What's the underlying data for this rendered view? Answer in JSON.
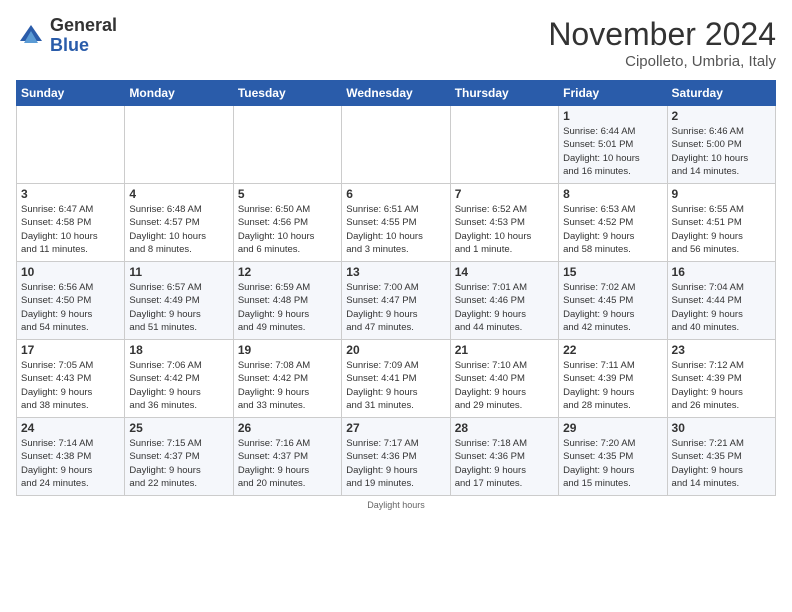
{
  "header": {
    "logo_general": "General",
    "logo_blue": "Blue",
    "month_title": "November 2024",
    "location": "Cipolleto, Umbria, Italy"
  },
  "calendar": {
    "days_of_week": [
      "Sunday",
      "Monday",
      "Tuesday",
      "Wednesday",
      "Thursday",
      "Friday",
      "Saturday"
    ],
    "footer_text": "Daylight hours",
    "weeks": [
      [
        {
          "day": "",
          "info": ""
        },
        {
          "day": "",
          "info": ""
        },
        {
          "day": "",
          "info": ""
        },
        {
          "day": "",
          "info": ""
        },
        {
          "day": "",
          "info": ""
        },
        {
          "day": "1",
          "info": "Sunrise: 6:44 AM\nSunset: 5:01 PM\nDaylight: 10 hours\nand 16 minutes."
        },
        {
          "day": "2",
          "info": "Sunrise: 6:46 AM\nSunset: 5:00 PM\nDaylight: 10 hours\nand 14 minutes."
        }
      ],
      [
        {
          "day": "3",
          "info": "Sunrise: 6:47 AM\nSunset: 4:58 PM\nDaylight: 10 hours\nand 11 minutes."
        },
        {
          "day": "4",
          "info": "Sunrise: 6:48 AM\nSunset: 4:57 PM\nDaylight: 10 hours\nand 8 minutes."
        },
        {
          "day": "5",
          "info": "Sunrise: 6:50 AM\nSunset: 4:56 PM\nDaylight: 10 hours\nand 6 minutes."
        },
        {
          "day": "6",
          "info": "Sunrise: 6:51 AM\nSunset: 4:55 PM\nDaylight: 10 hours\nand 3 minutes."
        },
        {
          "day": "7",
          "info": "Sunrise: 6:52 AM\nSunset: 4:53 PM\nDaylight: 10 hours\nand 1 minute."
        },
        {
          "day": "8",
          "info": "Sunrise: 6:53 AM\nSunset: 4:52 PM\nDaylight: 9 hours\nand 58 minutes."
        },
        {
          "day": "9",
          "info": "Sunrise: 6:55 AM\nSunset: 4:51 PM\nDaylight: 9 hours\nand 56 minutes."
        }
      ],
      [
        {
          "day": "10",
          "info": "Sunrise: 6:56 AM\nSunset: 4:50 PM\nDaylight: 9 hours\nand 54 minutes."
        },
        {
          "day": "11",
          "info": "Sunrise: 6:57 AM\nSunset: 4:49 PM\nDaylight: 9 hours\nand 51 minutes."
        },
        {
          "day": "12",
          "info": "Sunrise: 6:59 AM\nSunset: 4:48 PM\nDaylight: 9 hours\nand 49 minutes."
        },
        {
          "day": "13",
          "info": "Sunrise: 7:00 AM\nSunset: 4:47 PM\nDaylight: 9 hours\nand 47 minutes."
        },
        {
          "day": "14",
          "info": "Sunrise: 7:01 AM\nSunset: 4:46 PM\nDaylight: 9 hours\nand 44 minutes."
        },
        {
          "day": "15",
          "info": "Sunrise: 7:02 AM\nSunset: 4:45 PM\nDaylight: 9 hours\nand 42 minutes."
        },
        {
          "day": "16",
          "info": "Sunrise: 7:04 AM\nSunset: 4:44 PM\nDaylight: 9 hours\nand 40 minutes."
        }
      ],
      [
        {
          "day": "17",
          "info": "Sunrise: 7:05 AM\nSunset: 4:43 PM\nDaylight: 9 hours\nand 38 minutes."
        },
        {
          "day": "18",
          "info": "Sunrise: 7:06 AM\nSunset: 4:42 PM\nDaylight: 9 hours\nand 36 minutes."
        },
        {
          "day": "19",
          "info": "Sunrise: 7:08 AM\nSunset: 4:42 PM\nDaylight: 9 hours\nand 33 minutes."
        },
        {
          "day": "20",
          "info": "Sunrise: 7:09 AM\nSunset: 4:41 PM\nDaylight: 9 hours\nand 31 minutes."
        },
        {
          "day": "21",
          "info": "Sunrise: 7:10 AM\nSunset: 4:40 PM\nDaylight: 9 hours\nand 29 minutes."
        },
        {
          "day": "22",
          "info": "Sunrise: 7:11 AM\nSunset: 4:39 PM\nDaylight: 9 hours\nand 28 minutes."
        },
        {
          "day": "23",
          "info": "Sunrise: 7:12 AM\nSunset: 4:39 PM\nDaylight: 9 hours\nand 26 minutes."
        }
      ],
      [
        {
          "day": "24",
          "info": "Sunrise: 7:14 AM\nSunset: 4:38 PM\nDaylight: 9 hours\nand 24 minutes."
        },
        {
          "day": "25",
          "info": "Sunrise: 7:15 AM\nSunset: 4:37 PM\nDaylight: 9 hours\nand 22 minutes."
        },
        {
          "day": "26",
          "info": "Sunrise: 7:16 AM\nSunset: 4:37 PM\nDaylight: 9 hours\nand 20 minutes."
        },
        {
          "day": "27",
          "info": "Sunrise: 7:17 AM\nSunset: 4:36 PM\nDaylight: 9 hours\nand 19 minutes."
        },
        {
          "day": "28",
          "info": "Sunrise: 7:18 AM\nSunset: 4:36 PM\nDaylight: 9 hours\nand 17 minutes."
        },
        {
          "day": "29",
          "info": "Sunrise: 7:20 AM\nSunset: 4:35 PM\nDaylight: 9 hours\nand 15 minutes."
        },
        {
          "day": "30",
          "info": "Sunrise: 7:21 AM\nSunset: 4:35 PM\nDaylight: 9 hours\nand 14 minutes."
        }
      ]
    ]
  }
}
